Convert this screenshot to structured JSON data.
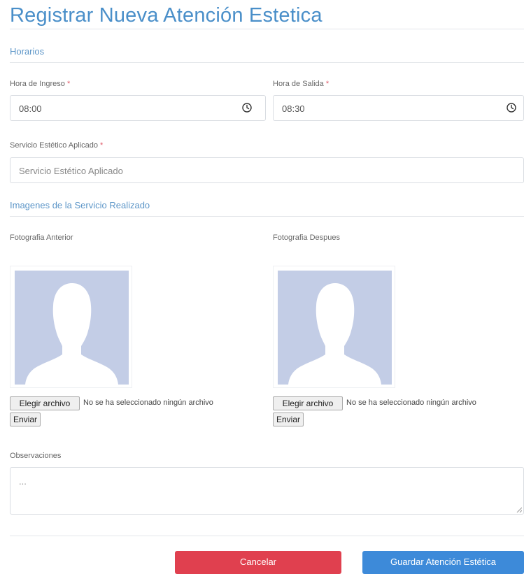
{
  "page": {
    "title": "Registrar Nueva Atención Estetica"
  },
  "horarios": {
    "section_title": "Horarios",
    "ingreso": {
      "label": "Hora de Ingreso",
      "required_mark": "*",
      "value": "08:00"
    },
    "salida": {
      "label": "Hora de Salida",
      "required_mark": "*",
      "value": "08:30"
    }
  },
  "servicio": {
    "label": "Servicio Estético Aplicado",
    "required_mark": "*",
    "placeholder": "Servicio Estético Aplicado"
  },
  "imagenes": {
    "section_title": "Imagenes de la Servicio Realizado",
    "anterior": {
      "label": "Fotografia Anterior",
      "choose_label": "Elegir archivo",
      "status": "No se ha seleccionado ningún archivo",
      "submit_label": "Enviar"
    },
    "despues": {
      "label": "Fotografia Despues",
      "choose_label": "Elegir archivo",
      "status": "No se ha seleccionado ningún archivo",
      "submit_label": "Enviar"
    }
  },
  "observaciones": {
    "label": "Observaciones",
    "placeholder": "..."
  },
  "actions": {
    "cancel_label": "Cancelar",
    "save_label": "Guardar Atención Estética"
  },
  "colors": {
    "title": "#4a8fc9",
    "section": "#5d96c8",
    "required": "#e05b6a",
    "cancel": "#e0404f",
    "save": "#3d8ad9",
    "avatar_bg": "#c3cde6"
  },
  "icons": {
    "time": "clock-icon",
    "avatar": "user-silhouette-icon"
  }
}
